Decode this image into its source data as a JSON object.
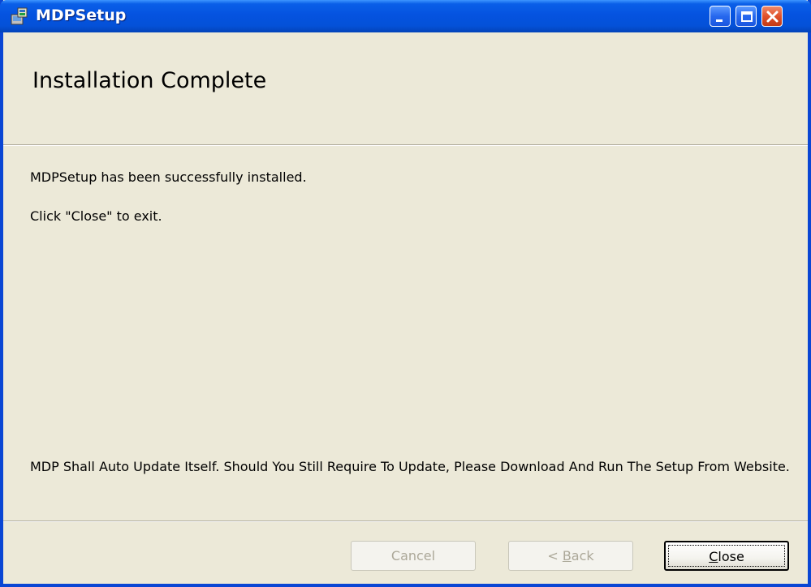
{
  "window": {
    "title": "MDPSetup",
    "icon": "setup-installer-icon"
  },
  "header": {
    "title": "Installation Complete"
  },
  "body": {
    "line1": "MDPSetup has been successfully installed.",
    "line2": "Click \"Close\" to exit.",
    "note": "MDP Shall Auto Update Itself. Should You Still Require To Update, Please Download And Run The Setup From Website."
  },
  "buttons": {
    "cancel": "Cancel",
    "back_prefix": "< ",
    "back_accel": "B",
    "back_rest": "ack",
    "close_accel": "C",
    "close_rest": "lose"
  },
  "colors": {
    "titlebar": "#0553e0",
    "window_bg": "#ece9d8",
    "close_button": "#e0512b"
  }
}
